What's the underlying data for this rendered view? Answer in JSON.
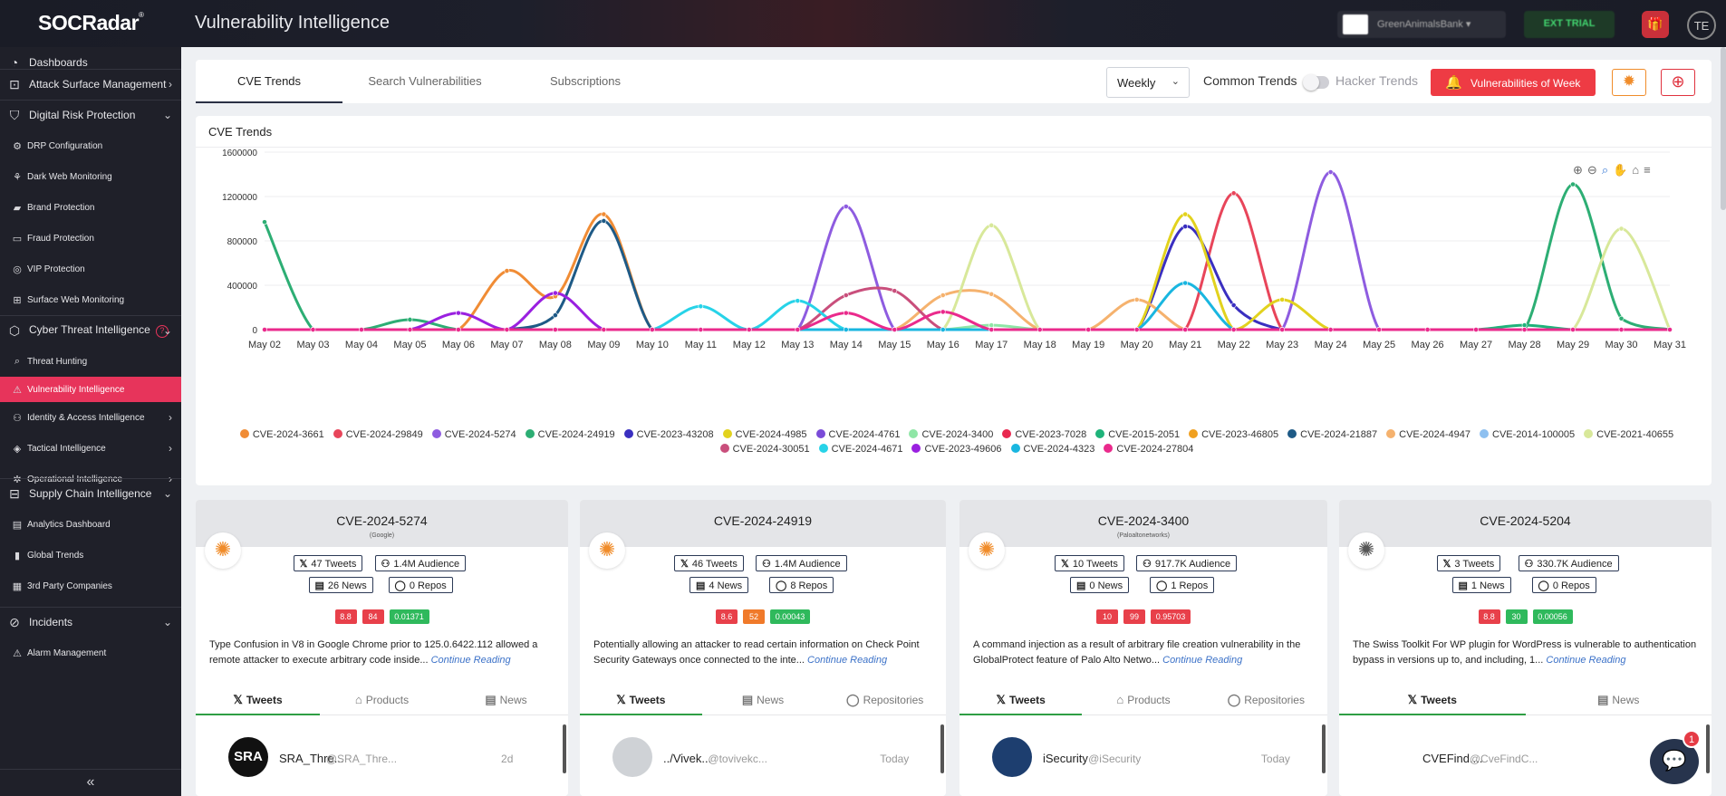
{
  "app": {
    "logo": "SOCRadar",
    "title": "Vulnerability Intelligence",
    "account_label": "GreenAnimalsBank",
    "trial_label": "EXT TRIAL",
    "avatar_initials": "TE"
  },
  "sidebar": {
    "items": [
      {
        "label": "Dashboards",
        "icon": "dashboard-icon"
      },
      {
        "label": "Attack Surface Management",
        "icon": "attack-surface-icon"
      },
      {
        "label": "Digital Risk Protection",
        "icon": "digital-risk-icon"
      },
      {
        "label": "DRP Configuration",
        "icon": "config-icon"
      },
      {
        "label": "Dark Web Monitoring",
        "icon": "darkweb-icon"
      },
      {
        "label": "Brand Protection",
        "icon": "brand-icon"
      },
      {
        "label": "Fraud Protection",
        "icon": "fraud-icon"
      },
      {
        "label": "VIP Protection",
        "icon": "vip-icon"
      },
      {
        "label": "Surface Web Monitoring",
        "icon": "surface-web-icon"
      },
      {
        "label": "Cyber Threat Intelligence",
        "icon": "cti-icon"
      },
      {
        "label": "Threat Hunting",
        "icon": "search-icon"
      },
      {
        "label": "Vulnerability Intelligence",
        "icon": "vulnerability-icon"
      },
      {
        "label": "Identity & Access Intelligence",
        "icon": "identity-icon"
      },
      {
        "label": "Tactical Intelligence",
        "icon": "tactical-icon"
      },
      {
        "label": "Operational Intelligence",
        "icon": "operational-icon"
      },
      {
        "label": "Supply Chain Intelligence",
        "icon": "supply-chain-icon"
      },
      {
        "label": "Analytics Dashboard",
        "icon": "analytics-icon"
      },
      {
        "label": "Global Trends",
        "icon": "trends-icon"
      },
      {
        "label": "3rd Party Companies",
        "icon": "companies-icon"
      },
      {
        "label": "Incidents",
        "icon": "incidents-icon"
      },
      {
        "label": "Alarm Management",
        "icon": "alarm-icon"
      }
    ],
    "help_badge": "?"
  },
  "tabs": [
    {
      "label": "CVE Trends",
      "active": true
    },
    {
      "label": "Search Vulnerabilities",
      "active": false
    },
    {
      "label": "Subscriptions",
      "active": false
    }
  ],
  "controls": {
    "period_value": "Weekly",
    "common_trends_label": "Common Trends",
    "hacker_trends_label": "Hacker Trends",
    "vow_button_label": "Vulnerabilities of Week"
  },
  "chart_panel_title": "CVE Trends",
  "chart_data": {
    "type": "line",
    "title": "",
    "xlabel": "",
    "ylabel": "",
    "ylim": [
      0,
      1600000
    ],
    "y_ticks": [
      "1600000",
      "1200000",
      "800000",
      "400000",
      "0"
    ],
    "x": [
      "May 02",
      "May 03",
      "May 04",
      "May 05",
      "May 06",
      "May 07",
      "May 08",
      "May 09",
      "May 10",
      "May 11",
      "May 12",
      "May 13",
      "May 14",
      "May 15",
      "May 16",
      "May 17",
      "May 18",
      "May 19",
      "May 20",
      "May 21",
      "May 22",
      "May 23",
      "May 24",
      "May 25",
      "May 26",
      "May 27",
      "May 28",
      "May 29",
      "May 30",
      "May 31"
    ],
    "series": [
      {
        "name": "CVE-2024-3661",
        "color": "#f08c35",
        "values": [
          0,
          0,
          0,
          0,
          0,
          530000,
          300000,
          1040000,
          0,
          0,
          0,
          0,
          0,
          0,
          0,
          0,
          0,
          0,
          0,
          0,
          0,
          0,
          0,
          0,
          0,
          0,
          0,
          0,
          0,
          0
        ]
      },
      {
        "name": "CVE-2024-29849",
        "color": "#e8455a",
        "values": [
          0,
          0,
          0,
          0,
          0,
          0,
          0,
          0,
          0,
          0,
          0,
          0,
          0,
          0,
          0,
          0,
          0,
          0,
          0,
          0,
          1230000,
          0,
          0,
          0,
          0,
          0,
          0,
          0,
          0,
          0
        ]
      },
      {
        "name": "CVE-2024-5274",
        "color": "#8e5ce0",
        "values": [
          0,
          0,
          0,
          0,
          0,
          0,
          0,
          0,
          0,
          0,
          0,
          0,
          1110000,
          0,
          0,
          0,
          0,
          0,
          0,
          0,
          0,
          0,
          1420000,
          0,
          0,
          0,
          0,
          0,
          0,
          0
        ]
      },
      {
        "name": "CVE-2024-24919",
        "color": "#2dae74",
        "values": [
          970000,
          0,
          0,
          90000,
          0,
          0,
          0,
          0,
          0,
          0,
          0,
          0,
          0,
          0,
          0,
          0,
          0,
          0,
          0,
          0,
          0,
          0,
          0,
          0,
          0,
          0,
          0,
          1310000,
          100000,
          0
        ]
      },
      {
        "name": "CVE-2023-43208",
        "color": "#3a2fc0",
        "values": [
          0,
          0,
          0,
          0,
          0,
          0,
          0,
          0,
          0,
          0,
          0,
          0,
          0,
          0,
          0,
          0,
          0,
          0,
          0,
          930000,
          220000,
          0,
          0,
          0,
          0,
          0,
          0,
          0,
          0,
          0
        ]
      },
      {
        "name": "CVE-2024-4985",
        "color": "#e2d21e",
        "values": [
          0,
          0,
          0,
          0,
          0,
          0,
          0,
          0,
          0,
          0,
          0,
          0,
          0,
          0,
          0,
          0,
          0,
          0,
          0,
          1040000,
          0,
          270000,
          0,
          0,
          0,
          0,
          0,
          0,
          0,
          0
        ]
      },
      {
        "name": "CVE-2024-4761",
        "color": "#7a4bd8",
        "values": [
          0,
          0,
          0,
          0,
          0,
          0,
          0,
          0,
          0,
          0,
          0,
          0,
          0,
          0,
          0,
          0,
          0,
          0,
          0,
          0,
          0,
          0,
          0,
          0,
          0,
          0,
          0,
          0,
          0,
          0
        ]
      },
      {
        "name": "CVE-2024-3400",
        "color": "#8fe6a6",
        "values": [
          0,
          0,
          0,
          0,
          0,
          0,
          0,
          0,
          0,
          0,
          0,
          0,
          0,
          0,
          0,
          40000,
          0,
          0,
          0,
          0,
          0,
          0,
          0,
          0,
          0,
          0,
          0,
          0,
          0,
          0
        ]
      },
      {
        "name": "CVE-2023-7028",
        "color": "#e8284f",
        "values": [
          0,
          0,
          0,
          0,
          0,
          0,
          0,
          0,
          0,
          0,
          0,
          0,
          0,
          0,
          0,
          0,
          0,
          0,
          0,
          0,
          0,
          0,
          0,
          0,
          0,
          0,
          0,
          0,
          0,
          0
        ]
      },
      {
        "name": "CVE-2015-2051",
        "color": "#1fb37a",
        "values": [
          0,
          0,
          0,
          0,
          0,
          0,
          0,
          0,
          0,
          0,
          0,
          0,
          0,
          0,
          0,
          0,
          0,
          0,
          0,
          0,
          0,
          0,
          0,
          0,
          0,
          0,
          40000,
          0,
          0,
          0
        ]
      },
      {
        "name": "CVE-2023-46805",
        "color": "#f0a020",
        "values": [
          0,
          0,
          0,
          0,
          0,
          0,
          0,
          0,
          0,
          0,
          0,
          0,
          0,
          0,
          0,
          0,
          0,
          0,
          0,
          0,
          0,
          0,
          0,
          0,
          0,
          0,
          0,
          0,
          0,
          0
        ]
      },
      {
        "name": "CVE-2024-21887",
        "color": "#1e5a86",
        "values": [
          0,
          0,
          0,
          0,
          0,
          0,
          130000,
          980000,
          0,
          0,
          0,
          0,
          0,
          0,
          0,
          0,
          0,
          0,
          0,
          0,
          0,
          0,
          0,
          0,
          0,
          0,
          0,
          0,
          0,
          0
        ]
      },
      {
        "name": "CVE-2024-4947",
        "color": "#f5b26e",
        "values": [
          0,
          0,
          0,
          0,
          0,
          0,
          0,
          0,
          0,
          0,
          0,
          0,
          0,
          0,
          310000,
          320000,
          0,
          0,
          270000,
          0,
          0,
          0,
          0,
          0,
          0,
          0,
          0,
          0,
          0,
          0
        ]
      },
      {
        "name": "CVE-2014-100005",
        "color": "#8ec0f0",
        "values": [
          0,
          0,
          0,
          0,
          0,
          0,
          0,
          0,
          0,
          0,
          0,
          0,
          0,
          0,
          0,
          0,
          0,
          0,
          0,
          0,
          0,
          0,
          0,
          0,
          0,
          0,
          0,
          0,
          0,
          0
        ]
      },
      {
        "name": "CVE-2021-40655",
        "color": "#d8e89a",
        "values": [
          0,
          0,
          0,
          0,
          0,
          0,
          0,
          0,
          0,
          0,
          0,
          0,
          0,
          0,
          0,
          940000,
          0,
          0,
          0,
          0,
          0,
          0,
          0,
          0,
          0,
          0,
          0,
          0,
          910000,
          0
        ]
      },
      {
        "name": "CVE-2024-30051",
        "color": "#c94f7c",
        "values": [
          0,
          0,
          0,
          0,
          0,
          0,
          0,
          0,
          0,
          0,
          0,
          0,
          310000,
          350000,
          0,
          0,
          0,
          0,
          0,
          0,
          0,
          0,
          0,
          0,
          0,
          0,
          0,
          0,
          0,
          0
        ]
      },
      {
        "name": "CVE-2024-4671",
        "color": "#27d3e8",
        "values": [
          0,
          0,
          0,
          0,
          0,
          0,
          0,
          0,
          0,
          210000,
          0,
          260000,
          0,
          0,
          0,
          0,
          0,
          0,
          0,
          0,
          0,
          0,
          0,
          0,
          0,
          0,
          0,
          0,
          0,
          0
        ]
      },
      {
        "name": "CVE-2023-49606",
        "color": "#9a20e0",
        "values": [
          0,
          0,
          0,
          0,
          150000,
          0,
          330000,
          0,
          0,
          0,
          0,
          0,
          0,
          0,
          0,
          0,
          0,
          0,
          0,
          0,
          0,
          0,
          0,
          0,
          0,
          0,
          0,
          0,
          0,
          0
        ]
      },
      {
        "name": "CVE-2024-4323",
        "color": "#19b6e0",
        "values": [
          0,
          0,
          0,
          0,
          0,
          0,
          0,
          0,
          0,
          0,
          0,
          0,
          0,
          0,
          0,
          0,
          0,
          0,
          0,
          420000,
          0,
          0,
          0,
          0,
          0,
          0,
          0,
          0,
          0,
          0
        ]
      },
      {
        "name": "CVE-2024-27804",
        "color": "#ea2a8c",
        "values": [
          0,
          0,
          0,
          0,
          0,
          0,
          0,
          0,
          0,
          0,
          0,
          0,
          150000,
          0,
          160000,
          0,
          0,
          0,
          0,
          0,
          0,
          0,
          0,
          0,
          0,
          0,
          0,
          0,
          0,
          0
        ]
      }
    ]
  },
  "cards": [
    {
      "cve": "CVE-2024-5274",
      "vendor": "(Google)",
      "icon_color": "#f08c2a",
      "tweets": "47 Tweets",
      "audience": "1.4M Audience",
      "news": "26 News",
      "repos": "0 Repos",
      "scores": [
        {
          "v": "8.8",
          "c": "red"
        },
        {
          "v": "84",
          "c": "red"
        },
        {
          "v": "0.01371",
          "c": "green"
        }
      ],
      "desc": "Type Confusion in V8 in Google Chrome prior to 125.0.6422.112 allowed a remote attacker to execute arbitrary code inside...",
      "more": "Continue Reading",
      "tabs": [
        "Tweets",
        "Products",
        "News"
      ],
      "tweet": {
        "avatar": "SRA",
        "name": "SRA_Thre...",
        "handle": "@SRA_Thre...",
        "time": "2d"
      }
    },
    {
      "cve": "CVE-2024-24919",
      "vendor": "",
      "icon_color": "#f08c2a",
      "tweets": "46 Tweets",
      "audience": "1.4M Audience",
      "news": "4 News",
      "repos": "8 Repos",
      "scores": [
        {
          "v": "8.6",
          "c": "red"
        },
        {
          "v": "52",
          "c": "orange"
        },
        {
          "v": "0.00043",
          "c": "green"
        }
      ],
      "desc": "Potentially allowing an attacker to read certain information on Check Point Security Gateways once connected to the inte...",
      "more": "Continue Reading",
      "tabs": [
        "Tweets",
        "News",
        "Repositories"
      ],
      "tweet": {
        "avatar": "",
        "name": "../Vivek...",
        "handle": "@tovivekc...",
        "time": "Today"
      }
    },
    {
      "cve": "CVE-2024-3400",
      "vendor": "(Paloaltonetworks)",
      "icon_color": "#f08c2a",
      "tweets": "10 Tweets",
      "audience": "917.7K Audience",
      "news": "0 News",
      "repos": "1 Repos",
      "scores": [
        {
          "v": "10",
          "c": "red"
        },
        {
          "v": "99",
          "c": "red"
        },
        {
          "v": "0.95703",
          "c": "red"
        }
      ],
      "desc": "A command injection as a result of arbitrary file creation vulnerability in the GlobalProtect feature of Palo Alto Netwo...",
      "more": "Continue Reading",
      "tabs": [
        "Tweets",
        "Products",
        "Repositories"
      ],
      "tweet": {
        "avatar": "",
        "name": "iSecurity",
        "handle": "@iSecurity",
        "time": "Today"
      }
    },
    {
      "cve": "CVE-2024-5204",
      "vendor": "",
      "icon_color": "#555555",
      "tweets": "3 Tweets",
      "audience": "330.7K Audience",
      "news": "1 News",
      "repos": "0 Repos",
      "scores": [
        {
          "v": "8.8",
          "c": "red"
        },
        {
          "v": "30",
          "c": "green"
        },
        {
          "v": "0.00056",
          "c": "green"
        }
      ],
      "desc": "The Swiss Toolkit For WP plugin for WordPress is vulnerable to authentication bypass in versions up to, and including, 1...",
      "more": "Continue Reading",
      "tabs": [
        "Tweets",
        "News"
      ],
      "tweet": {
        "avatar": "",
        "name": "CVEFind....",
        "handle": "@CveFindC...",
        "time": ""
      }
    }
  ],
  "chat_badge": "1"
}
